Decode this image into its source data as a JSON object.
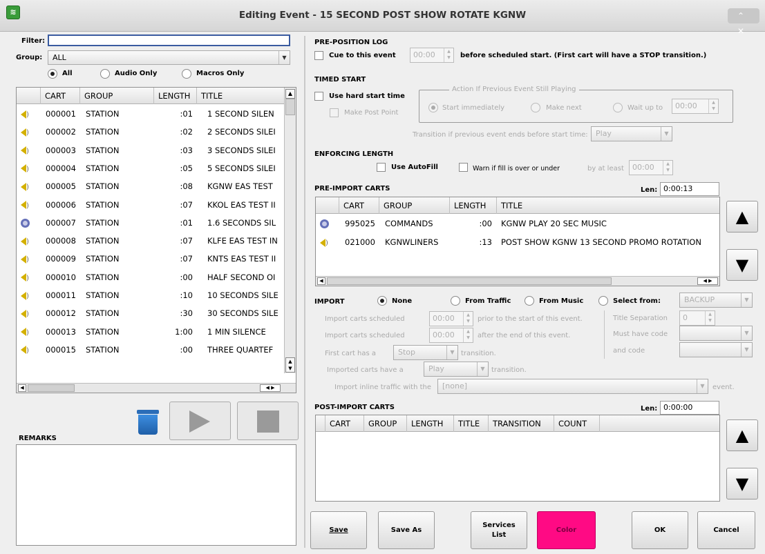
{
  "window": {
    "title": "Editing Event - 15 SECOND POST SHOW ROTATE  KGNW",
    "app_icon": "rdlogmanager-icon",
    "controls": "⌃ ✕"
  },
  "left": {
    "filter_label": "Filter:",
    "filter_value": "",
    "group_label": "Group:",
    "group_value": "ALL",
    "radio_all": "All",
    "radio_audio": "Audio Only",
    "radio_macros": "Macros Only",
    "library_columns": [
      "CART",
      "GROUP",
      "LENGTH",
      "TITLE"
    ],
    "library_rows": [
      {
        "icon": "speaker-icon",
        "cart": "000001",
        "group": "STATION",
        "length": ":01",
        "title": "1 SECOND SILEN"
      },
      {
        "icon": "speaker-icon",
        "cart": "000002",
        "group": "STATION",
        "length": ":02",
        "title": "2 SECONDS SILEI"
      },
      {
        "icon": "speaker-icon",
        "cart": "000003",
        "group": "STATION",
        "length": ":03",
        "title": "3 SECONDS SILEI"
      },
      {
        "icon": "speaker-icon",
        "cart": "000004",
        "group": "STATION",
        "length": ":05",
        "title": "5 SECONDS SILEI"
      },
      {
        "icon": "speaker-icon",
        "cart": "000005",
        "group": "STATION",
        "length": ":08",
        "title": "KGNW EAS TEST"
      },
      {
        "icon": "speaker-icon",
        "cart": "000006",
        "group": "STATION",
        "length": ":07",
        "title": "KKOL EAS TEST II"
      },
      {
        "icon": "macro-gear-icon",
        "cart": "000007",
        "group": "STATION",
        "length": ":01",
        "title": "1.6 SECONDS SIL"
      },
      {
        "icon": "speaker-icon",
        "cart": "000008",
        "group": "STATION",
        "length": ":07",
        "title": "KLFE EAS TEST IN"
      },
      {
        "icon": "speaker-icon",
        "cart": "000009",
        "group": "STATION",
        "length": ":07",
        "title": "KNTS EAS TEST II"
      },
      {
        "icon": "speaker-icon",
        "cart": "000010",
        "group": "STATION",
        "length": ":00",
        "title": "HALF SECOND OI"
      },
      {
        "icon": "speaker-icon",
        "cart": "000011",
        "group": "STATION",
        "length": ":10",
        "title": "10 SECONDS SILE"
      },
      {
        "icon": "speaker-icon",
        "cart": "000012",
        "group": "STATION",
        "length": ":30",
        "title": "30 SECONDS SILE"
      },
      {
        "icon": "speaker-icon",
        "cart": "000013",
        "group": "STATION",
        "length": "1:00",
        "title": "1 MIN SILENCE"
      },
      {
        "icon": "speaker-icon",
        "cart": "000015",
        "group": "STATION",
        "length": ":00",
        "title": "THREE QUARTEF"
      }
    ],
    "remarks_label": "REMARKS",
    "remarks_value": ""
  },
  "right": {
    "prepos_title": "PRE-POSITION LOG",
    "cue_label": "Cue to this event",
    "cue_time": "00:00",
    "cue_suffix": "before scheduled start.  (First cart will have a STOP transition.)",
    "timed_title": "TIMED START",
    "hard_start_label": "Use hard start time",
    "post_point_label": "Make Post Point",
    "action_title": "Action If Previous Event Still Playing",
    "start_immediately": "Start immediately",
    "make_next": "Make next",
    "wait_up_to": "Wait up to",
    "wait_time": "00:00",
    "transition_label": "Transition if previous event ends before start time:",
    "transition_value": "Play",
    "enforce_title": "ENFORCING LENGTH",
    "autofill_label": "Use AutoFill",
    "warn_label": "Warn if fill is over or under",
    "by_at_least": "by at least",
    "by_time": "00:00",
    "preimport_title": "PRE-IMPORT CARTS",
    "len_label": "Len:",
    "pre_len": "0:00:13",
    "pre_columns": [
      "CART",
      "GROUP",
      "LENGTH",
      "TITLE"
    ],
    "pre_rows": [
      {
        "icon": "macro-gear-icon",
        "cart": "995025",
        "group": "COMMANDS",
        "length": ":00",
        "title": "KGNW PLAY 20 SEC MUSIC"
      },
      {
        "icon": "speaker-icon",
        "cart": "021000",
        "group": "KGNWLINERS",
        "length": ":13",
        "title": "POST SHOW KGNW 13 SECOND PROMO ROTATION"
      }
    ],
    "import_title": "IMPORT",
    "imp_none": "None",
    "imp_traffic": "From Traffic",
    "imp_music": "From Music",
    "imp_select": "Select from:",
    "imp_select_value": "BACKUP",
    "imp_sched1": "Import carts scheduled",
    "imp_time1": "00:00",
    "imp_prior": "prior to the start of this event.",
    "imp_sched2": "Import carts scheduled",
    "imp_time2": "00:00",
    "imp_after": "after the end of this event.",
    "first_cart": "First cart has a",
    "first_value": "Stop",
    "first_trans": "transition.",
    "imported_have": "Imported carts have a",
    "imported_value": "Play",
    "imported_trans": "transition.",
    "inline_label": "Import inline traffic with the",
    "inline_value": "[none]",
    "inline_event": "event.",
    "title_sep": "Title Separation",
    "title_sep_value": "0",
    "must_have": "Must have code",
    "and_code": "and code",
    "postimport_title": "POST-IMPORT CARTS",
    "post_len": "0:00:00",
    "post_columns": [
      "CART",
      "GROUP",
      "LENGTH",
      "TITLE",
      "TRANSITION",
      "COUNT"
    ]
  },
  "buttons": {
    "save": "Save",
    "save_as": "Save As",
    "services_1": "Services",
    "services_2": "List",
    "color": "Color",
    "ok": "OK",
    "cancel": "Cancel"
  },
  "colors": {
    "color_button": "#ff0a84",
    "titlebar": "#e4e4e4"
  }
}
